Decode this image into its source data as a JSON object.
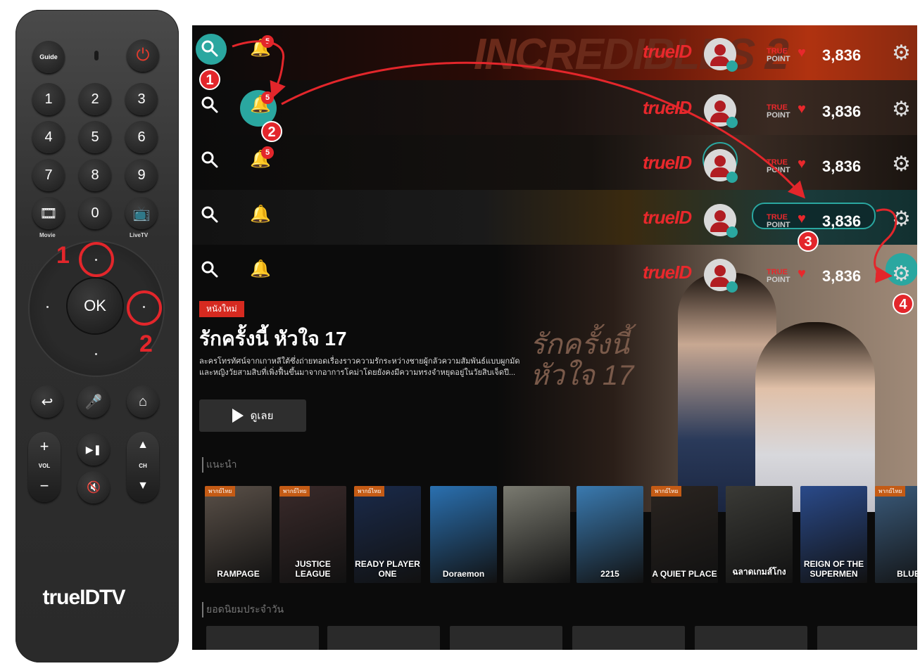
{
  "remote": {
    "guide_label": "Guide",
    "digits": [
      "1",
      "2",
      "3",
      "4",
      "5",
      "6",
      "7",
      "8",
      "9",
      "0"
    ],
    "movie_label": "Movie",
    "livetv_label": "LiveTV",
    "ok_label": "OK",
    "vol_label": "VOL",
    "ch_label": "CH",
    "plus_label": "+",
    "minus_label": "−",
    "brand": "trueIDTV",
    "callout_1": "1",
    "callout_2": "2"
  },
  "tv": {
    "brand": "trueID",
    "bell_badge": "5",
    "true_point_line1": "TRUE",
    "true_point_line2": "POINT",
    "points": "3,836",
    "step_badges": [
      "1",
      "2",
      "3",
      "4"
    ],
    "hero": {
      "tag": "หนังใหม่",
      "title": "รักครั้งนี้ หัวใจ 17",
      "description": "ละครโทรทัศน์จากเกาหลีใต้ซึ่งถ่ายทอดเรื่องราวความรักระหว่างชายผู้กลัวความสัมพันธ์แบบผูกมัดและหญิงวัยสามสิบที่เพิ่งฟื้นขึ้นมาจากอาการโคม่าโดยยังคงมีความทรงจำหยุดอยู่ในวัยสิบเจ็ดปี...",
      "play_label": "ดูเลย",
      "poster_text": "รักครั้งนี้ หัวใจ 17",
      "banner_text": "INCREDIBLES 2"
    },
    "section1_label": "แนะนำ",
    "section2_label": "ยอดนิยมประจำวัน",
    "posters": [
      {
        "label": "RAMPAGE",
        "ribbon": "พากย์ไทย",
        "color": "#5a5048"
      },
      {
        "label": "JUSTICE LEAGUE",
        "ribbon": "พากย์ไทย",
        "color": "#3a2a2a"
      },
      {
        "label": "READY PLAYER ONE",
        "ribbon": "พากย์ไทย",
        "color": "#1a2a4a"
      },
      {
        "label": "Doraemon",
        "ribbon": "",
        "color": "#2a70b0"
      },
      {
        "label": "",
        "ribbon": "",
        "color": "#7a7a70"
      },
      {
        "label": "2215",
        "ribbon": "",
        "color": "#3a7ab0"
      },
      {
        "label": "A QUIET PLACE",
        "ribbon": "พากย์ไทย",
        "color": "#2a2420"
      },
      {
        "label": "ฉลาดเกมส์โกง",
        "ribbon": "",
        "color": "#3a3a36"
      },
      {
        "label": "REIGN OF THE SUPERMEN",
        "ribbon": "",
        "color": "#2a4a8a"
      },
      {
        "label": "BLUE",
        "ribbon": "พากย์ไทย",
        "color": "#3a5a7a"
      }
    ]
  },
  "colors": {
    "accent_teal": "#2aa7a0",
    "annotation_red": "#e3262b",
    "brand_red": "#e8282c"
  }
}
